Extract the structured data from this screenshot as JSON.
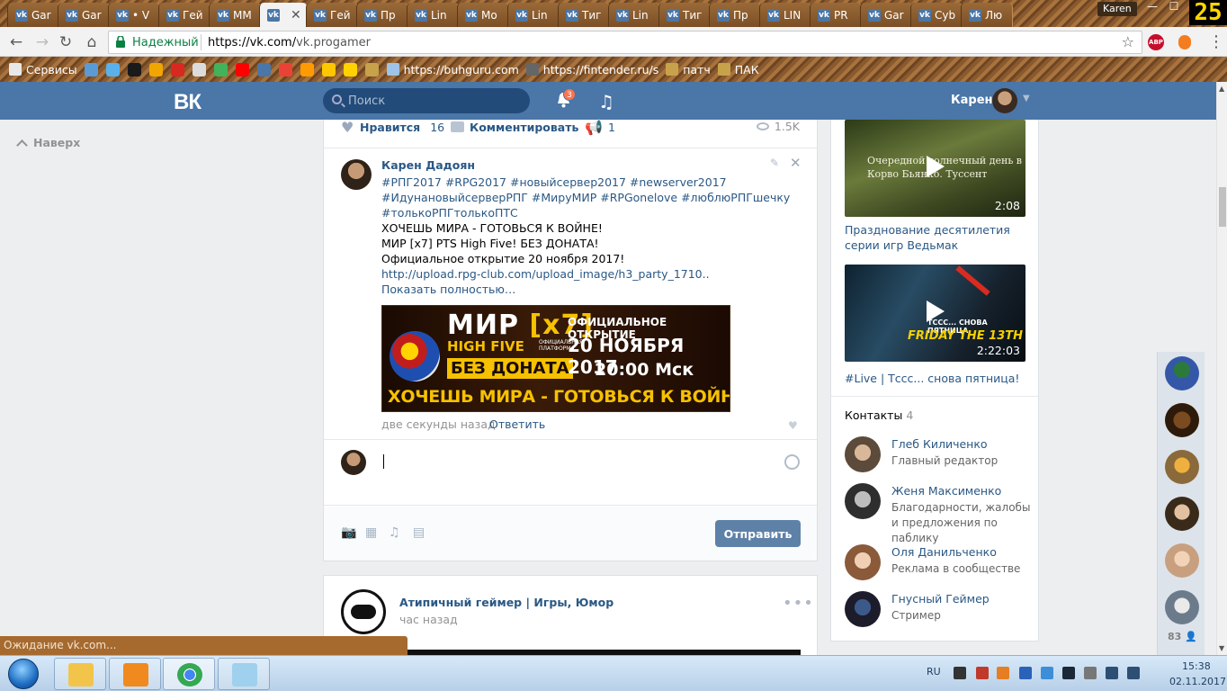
{
  "browser": {
    "tabs": [
      {
        "label": "Gar",
        "favicon": "vk-icon"
      },
      {
        "label": "Gar",
        "favicon": "vk-icon"
      },
      {
        "label": "• V",
        "favicon": "vk-icon"
      },
      {
        "label": "Гей",
        "favicon": "vk-icon"
      },
      {
        "label": "ММ",
        "favicon": "vk-icon"
      },
      {
        "label": "",
        "favicon": "vk-icon",
        "active": true
      },
      {
        "label": "Гей",
        "favicon": "vk-icon"
      },
      {
        "label": "Пр",
        "favicon": "vk-icon"
      },
      {
        "label": "Lin",
        "favicon": "vk-icon"
      },
      {
        "label": "Mo",
        "favicon": "vk-icon"
      },
      {
        "label": "Lin",
        "favicon": "vk-icon"
      },
      {
        "label": "Тиг",
        "favicon": "vk-icon"
      },
      {
        "label": "Lin",
        "favicon": "vk-icon"
      },
      {
        "label": "Тиг",
        "favicon": "vk-icon"
      },
      {
        "label": "Пр",
        "favicon": "vk-icon"
      },
      {
        "label": "LIN",
        "favicon": "vk-icon"
      },
      {
        "label": "PR",
        "favicon": "vk-icon"
      },
      {
        "label": "Gar",
        "favicon": "vk-icon"
      },
      {
        "label": "Cyb",
        "favicon": "vk-icon"
      },
      {
        "label": "Лю",
        "favicon": "vk-icon"
      }
    ],
    "profile_name": "Karen",
    "clock_badge": "25",
    "secure_label": "Надежный",
    "url_host": "https://vk.com/",
    "url_path": "vk.progamer",
    "abp_badge": "ABP",
    "bookmarks": [
      {
        "label": "Сервисы",
        "icon": "apps-icon",
        "color": "#e8e8e8"
      },
      {
        "label": "",
        "icon": "globe-icon",
        "color": "#5b9bd5"
      },
      {
        "label": "",
        "icon": "dropbox-icon",
        "color": "#5ab0ea"
      },
      {
        "label": "",
        "icon": "trello-icon",
        "color": "#1a1a1a"
      },
      {
        "label": "",
        "icon": "at-icon",
        "color": "#f0a500"
      },
      {
        "label": "",
        "icon": "red-logo-icon",
        "color": "#d9281f"
      },
      {
        "label": "",
        "icon": "mask-icon",
        "color": "#dcdcdc"
      },
      {
        "label": "",
        "icon": "colorful-icon",
        "color": "#42b35b"
      },
      {
        "label": "",
        "icon": "youtube-icon",
        "color": "#ff0000"
      },
      {
        "label": "",
        "icon": "vk-icon",
        "color": "#4a76a8"
      },
      {
        "label": "",
        "icon": "gmail-icon",
        "color": "#ea4335"
      },
      {
        "label": "",
        "icon": "q-icon",
        "color": "#ff9b00"
      },
      {
        "label": "",
        "icon": "runner-icon",
        "color": "#ffc700"
      },
      {
        "label": "",
        "icon": "k-icon",
        "color": "#ffd200"
      },
      {
        "label": "",
        "icon": "emblem-icon",
        "color": "#c8a24a"
      },
      {
        "label": "https://buhguru.com",
        "icon": "page-icon",
        "color": "#9fc3e6"
      },
      {
        "label": "https://fintender.ru/s",
        "icon": "hammer-icon",
        "color": "#666666"
      },
      {
        "label": "патч",
        "icon": "crest-icon",
        "color": "#c8a24a"
      },
      {
        "label": "ПАК",
        "icon": "crest-icon",
        "color": "#c8a24a"
      }
    ],
    "status_text": "Ожидание vk.com..."
  },
  "vk_header": {
    "logo": "ВК",
    "search_placeholder": "Поиск",
    "notifications_count": "3",
    "user_name": "Карен"
  },
  "left_nav": {
    "back_to_top": "Наверх"
  },
  "post": {
    "like_label": "Нравится",
    "like_count": "16",
    "comment_label": "Комментировать",
    "share_count": "1",
    "views": "1.5K"
  },
  "comment": {
    "author": "Карен Дадоян",
    "hashtags_1": "#РПГ2017 #RPG2017 #новыйсервер2017 #newserver2017",
    "hashtags_2": "#ИдунановыйсерверРПГ #МируМИР #RPGonelove #люблюРПГшечку",
    "hashtags_3": "#толькоРПГтолькоПТС",
    "line_1": "ХОЧЕШЬ МИРА - ГОТОВЬСЯ К ВОЙНЕ!",
    "line_2": "МИР [x7] PTS High Five! БЕЗ ДОНАТА!",
    "line_3": "Официальное открытие 20 ноября 2017!",
    "link": "http://upload.rpg-club.com/upload_image/h3_party_1710..",
    "show_more": "Показать полностью…",
    "banner": {
      "title_left": "МИР",
      "title_x7": "[x7]",
      "high_five": "HIGH FIVE",
      "small_text": "ОФИЦИАЛЬНАЯ ПЛАТФОРМА",
      "no_donate": "БЕЗ ДОНАТА",
      "official_open": "ОФИЦИАЛЬНОЕ ОТКРЫТИЕ",
      "date": "20 НОЯБРЯ 2017",
      "time": "20:00 Мск",
      "bottom": "ХОЧЕШЬ МИРА - ГОТОВЬСЯ К ВОЙНЕ"
    },
    "time": "две секунды назад",
    "reply_label": "Ответить"
  },
  "reply_box": {
    "input_value": "",
    "send_label": "Отправить"
  },
  "next_post": {
    "name": "Атипичный геймер | Игры, Юмор",
    "time": "час назад"
  },
  "right_column": {
    "videos": [
      {
        "thumb_caption_1": "Очередной солнечный день в",
        "thumb_caption_2": "Корво Бьянко. Туссент",
        "duration": "2:08",
        "title": "Празднование десятилетия серии игр Ведьмак"
      },
      {
        "thumb_text_small": "ТССС... СНОВА ПЯТНИЦА",
        "thumb_caption": "FRIDAY THE 13TH",
        "duration": "2:22:03",
        "title": "#Live | Тссс... снова пятница!"
      }
    ],
    "contacts_title": "Контакты",
    "contacts_count": "4",
    "contacts": [
      {
        "name": "Глеб Киличенко",
        "role": "Главный редактор"
      },
      {
        "name": "Женя Максименко",
        "role": "Благодарности, жалобы и предложения по паблику"
      },
      {
        "name": "Оля Данильченко",
        "role": "Реклама в сообществе"
      },
      {
        "name": "Гнусный Геймер",
        "role": "Стример"
      }
    ]
  },
  "rail": {
    "online_count": "83"
  },
  "taskbar": {
    "lang": "RU",
    "time": "15:38",
    "date": "02.11.2017"
  },
  "colors": {
    "vk_blue": "#4a76a8",
    "link": "#2a5885",
    "send_button": "#5e81a8",
    "page_bg": "#edeef0"
  }
}
